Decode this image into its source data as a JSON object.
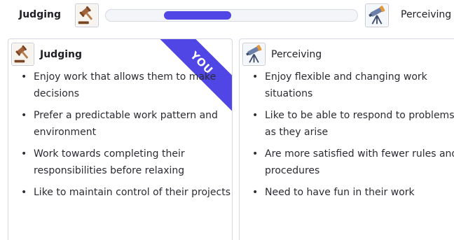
{
  "top_bar": {
    "left_label": "Judging",
    "right_label": "Perceiving",
    "left_icon": "gavel-icon",
    "right_icon": "telescope-icon",
    "indicator": {
      "start_fraction": 0.23,
      "end_fraction": 0.5,
      "color": "#5046e5"
    }
  },
  "cards": [
    {
      "title": "Judging",
      "icon": "gavel-icon",
      "badge": "YOU",
      "bullets": [
        "Enjoy work that allows them to make decisions",
        "Prefer a predictable work pattern and environment",
        "Work towards completing their responsibilities before relaxing",
        "Like to maintain control of their projects"
      ]
    },
    {
      "title": "Perceiving",
      "icon": "telescope-icon",
      "bullets": [
        "Enjoy flexible and changing work situations",
        "Like to be able to respond to problems as they arise",
        "Are more satisfied with fewer rules and procedures",
        "Need to have fun in their work"
      ]
    }
  ],
  "colors": {
    "accent": "#5046e5",
    "border": "#d6d8e2",
    "text": "#2b2b33"
  }
}
